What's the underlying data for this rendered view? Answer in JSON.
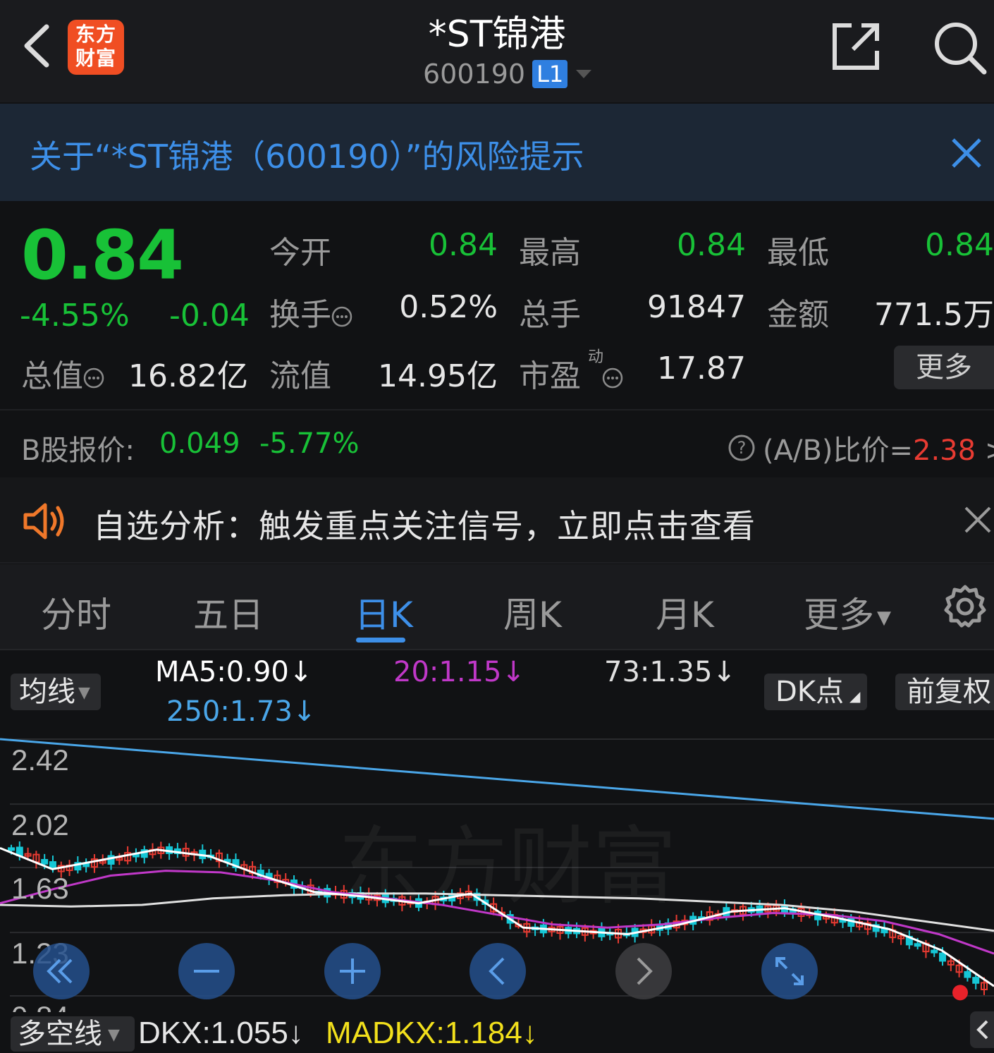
{
  "header": {
    "title": "*ST锦港",
    "code": "600190",
    "level_badge": "L1",
    "logo_text_line1": "东方",
    "logo_text_line2": "财富",
    "icons": [
      "back-chevron-icon",
      "share-icon",
      "search-icon"
    ]
  },
  "risk_banner": {
    "text": "关于“*ST锦港（600190）”的风险提示"
  },
  "quote": {
    "price": "0.84",
    "change_pct": "-4.55%",
    "change": "-0.04",
    "open_label": "今开",
    "open": "0.84",
    "high_label": "最高",
    "high": "0.84",
    "low_label": "最低",
    "low": "0.84",
    "turnover_label": "换手",
    "turnover": "0.52%",
    "volume_label": "总手",
    "volume": "91847",
    "amount_label": "金额",
    "amount": "771.5万",
    "mktcap_label": "总值",
    "mktcap": "16.82亿",
    "float_label": "流值",
    "float": "14.95亿",
    "pe_label": "市盈",
    "pe_sup": "动",
    "pe": "17.87",
    "more": "更多"
  },
  "b_share": {
    "label": "B股报价:",
    "price": "0.049",
    "pct": "-5.77%",
    "ab_label": "(A/B)比价=",
    "ab_value": "2.38",
    "arrow": ">"
  },
  "announce": {
    "text": "自选分析：触发重点关注信号，立即点击查看"
  },
  "tabs": [
    {
      "label": "分时"
    },
    {
      "label": "五日"
    },
    {
      "label": "日K"
    },
    {
      "label": "周K"
    },
    {
      "label": "月K"
    },
    {
      "label": "更多"
    }
  ],
  "ma_legend": {
    "selector": "均线",
    "ma5": "MA5:0.90↓",
    "ma20": "20:1.15↓",
    "ma73": "73:1.35↓",
    "ma250": "250:1.73↓",
    "dk_button": "DK点",
    "adj_button": "前复权",
    "colors": {
      "ma5": "#ffffff",
      "ma20": "#c038c8",
      "ma73": "#e0e0e0",
      "ma250": "#4aa6e8",
      "up": "#e83b32",
      "down": "#16c7d6"
    }
  },
  "chart_data": {
    "type": "candlestick",
    "y_ticks": [
      "2.42",
      "2.02",
      "1.63",
      "1.23",
      "0.84"
    ],
    "ylim": [
      0.84,
      2.42
    ],
    "watermark": "东方财富",
    "ma250": [
      2.42,
      2.35,
      2.28,
      2.21,
      2.14,
      2.07,
      2.0,
      1.93
    ],
    "ma73": [
      1.4,
      1.39,
      1.4,
      1.44,
      1.46,
      1.47,
      1.47,
      1.46,
      1.45,
      1.44,
      1.42,
      1.4,
      1.36,
      1.3,
      1.24
    ],
    "ma20": [
      1.41,
      1.5,
      1.58,
      1.61,
      1.6,
      1.55,
      1.48,
      1.44,
      1.4,
      1.34,
      1.28,
      1.26,
      1.28,
      1.32,
      1.35,
      1.34,
      1.3,
      1.22,
      1.1
    ],
    "ma5": [
      1.75,
      1.62,
      1.68,
      1.74,
      1.7,
      1.58,
      1.48,
      1.45,
      1.41,
      1.47,
      1.26,
      1.24,
      1.22,
      1.28,
      1.36,
      1.38,
      1.32,
      1.25,
      1.12,
      0.9
    ],
    "last_marker": 0.86
  },
  "controls": [
    "fast-back-icon",
    "zoom-out-icon",
    "zoom-in-icon",
    "prev-icon",
    "next-icon",
    "fullscreen-icon"
  ],
  "indicator": {
    "selector": "多空线",
    "dkx": "DKX:1.055↓",
    "madkx": "MADKX:1.184↓"
  }
}
